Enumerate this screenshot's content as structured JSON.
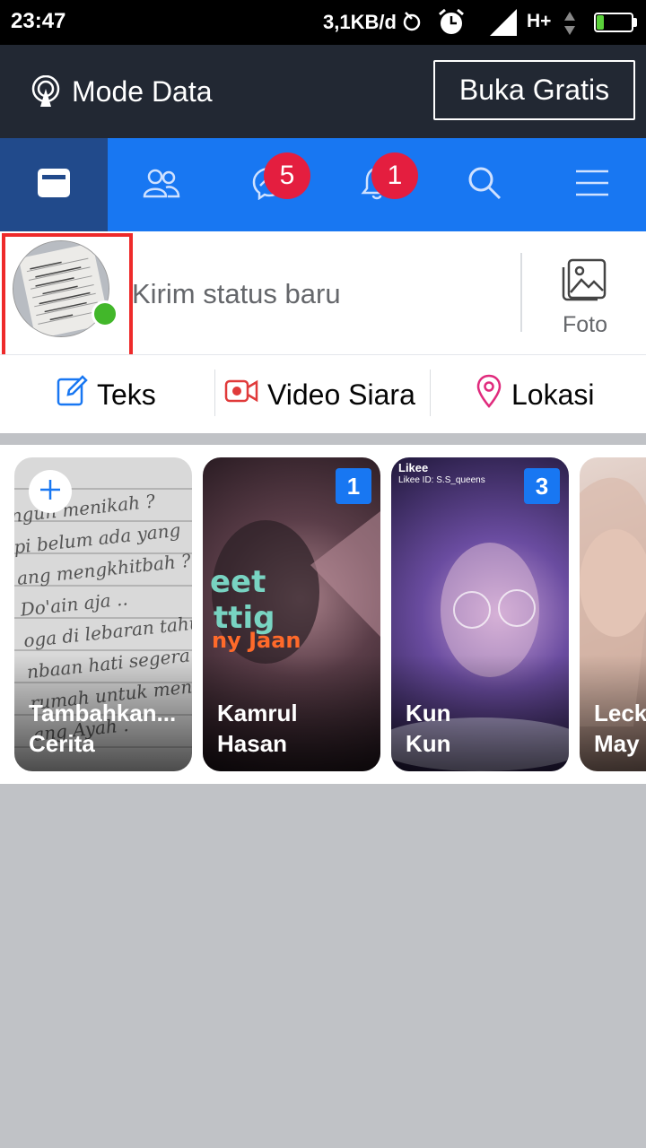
{
  "status_bar": {
    "time": "23:47",
    "speed": "3,1KB/d",
    "network": "H+",
    "battery": "21",
    "battery_level": 0.21
  },
  "data_mode": {
    "label": "Mode Data",
    "free_button": "Buka Gratis"
  },
  "nav": {
    "tabs": [
      {
        "name": "feed",
        "icon": "news-feed-icon",
        "active": true
      },
      {
        "name": "friends",
        "icon": "friends-icon"
      },
      {
        "name": "messages",
        "icon": "messenger-icon",
        "badge": "5"
      },
      {
        "name": "notifications",
        "icon": "bell-icon",
        "badge": "1"
      },
      {
        "name": "search",
        "icon": "search-icon"
      },
      {
        "name": "menu",
        "icon": "hamburger-menu-icon"
      }
    ]
  },
  "composer": {
    "placeholder": "Kirim status baru",
    "photo_label": "Foto",
    "actions": [
      {
        "label": "Teks",
        "icon": "edit-icon"
      },
      {
        "label": "Video Siara",
        "icon": "live-video-icon"
      },
      {
        "label": "Lokasi",
        "icon": "location-pin-icon"
      }
    ]
  },
  "stories": [
    {
      "name_line1": "Tambahkan...",
      "name_line2": "Cerita",
      "count": null
    },
    {
      "name_line1": "Kamrul",
      "name_line2": "Hasan",
      "count": "1"
    },
    {
      "name_line1": "Kun",
      "name_line2": "Kun",
      "count": "3",
      "overlay_title": "Likee",
      "overlay_sub": "Likee ID: S.S_queens"
    },
    {
      "name_line1": "Leck",
      "name_line2": "May",
      "count": null
    }
  ],
  "colors": {
    "brand": "#1877f2",
    "active_tab": "#214a8b",
    "badge": "#e41e3f",
    "online": "#42b72a",
    "mode_bar": "#222833"
  }
}
